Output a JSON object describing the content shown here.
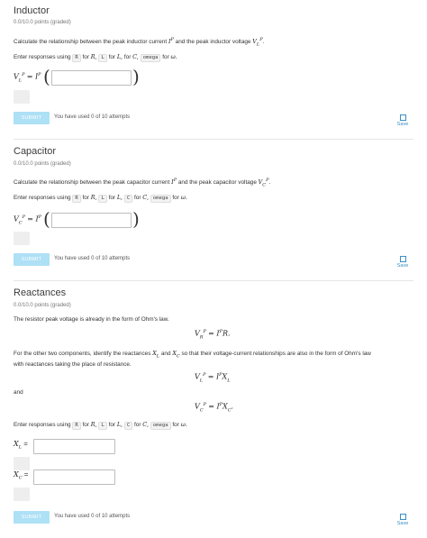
{
  "sections": [
    {
      "title": "Inductor",
      "points": "0.0/10.0 points (graded)",
      "prompt": "Calculate the relationship between the peak inductor current",
      "prompt_sym1": "I",
      "prompt_sym1_sup": "P",
      "prompt_mid": "and the peak inductor voltage",
      "prompt_sym2": "V",
      "prompt_sym2_sup": "P",
      "prompt_sym2_sub": "L",
      "prompt_end": ".",
      "enter_prefix": "Enter responses using",
      "codes": [
        "R",
        "L",
        "omega"
      ],
      "for_R": "for",
      "R": "R,",
      "for_L": "for",
      "L": "L,",
      "for_C": "for",
      "C": "C,",
      "for_w": "for",
      "w": "ω.",
      "eq_lhs": "V",
      "eq_lhs_sup": "P",
      "eq_lhs_sub": "L",
      "eq_mid": "= I",
      "eq_mid_sup": "P",
      "submit": "SUBMIT",
      "attempts": "You have used 0 of 10 attempts",
      "save": "Save"
    },
    {
      "title": "Capacitor",
      "points": "0.0/10.0 points (graded)",
      "prompt": "Calculate the relationship between the peak capacitor current",
      "prompt_sym1": "I",
      "prompt_sym1_sup": "P",
      "prompt_mid": "and the peak capacitor voltage",
      "prompt_sym2": "V",
      "prompt_sym2_sup": "P",
      "prompt_sym2_sub": "C",
      "prompt_end": ".",
      "enter_prefix": "Enter responses using",
      "codes": [
        "R",
        "L",
        "C",
        "omega"
      ],
      "for_R": "for",
      "R": "R,",
      "for_L": "for",
      "L": "L,",
      "for_C": "for",
      "C": "C,",
      "for_w": "for",
      "w": "ω.",
      "eq_lhs": "V",
      "eq_lhs_sup": "P",
      "eq_lhs_sub": "C",
      "eq_mid": "= I",
      "eq_mid_sup": "P",
      "submit": "SUBMIT",
      "attempts": "You have used 0 of 10 attempts",
      "save": "Save"
    },
    {
      "title": "Reactances",
      "points": "0.0/10.0 points (graded)",
      "p1": "The resistor peak voltage is already in the form of Ohm's law.",
      "eq1_lhs": "V",
      "eq1_lhs_sup": "P",
      "eq1_lhs_sub": "R",
      "eq1_rhs": "= I",
      "eq1_rhs_sup": "P",
      "eq1_rhs_end": "R.",
      "p2a": "For the other two components, identify the reactances",
      "p2_XL": "X",
      "p2_XL_sub": "L",
      "p2_and": "and",
      "p2_XC": "X",
      "p2_XC_sub": "C",
      "p2b": "so that their voltage-current relationships are also in the form of Ohm's law",
      "p2c": "with reactances taking the place of resistance.",
      "eq2_lhs": "V",
      "eq2_lhs_sup": "P",
      "eq2_lhs_sub": "L",
      "eq2_rhs": "= I",
      "eq2_rhs_sup": "P",
      "eq2_rhs_end": "X",
      "eq2_rhs_end_sub": "L",
      "and": "and",
      "eq3_lhs": "V",
      "eq3_lhs_sup": "P",
      "eq3_lhs_sub": "C",
      "eq3_rhs": "= I",
      "eq3_rhs_sup": "P",
      "eq3_rhs_end": "X",
      "eq3_rhs_end_sub": "C",
      "eq3_dot": ".",
      "enter_prefix": "Enter responses using",
      "codes": [
        "R",
        "L",
        "C",
        "omega"
      ],
      "for_R": "for",
      "R": "R,",
      "for_L": "for",
      "L": "L,",
      "for_C": "for",
      "C": "C,",
      "for_w": "for",
      "w": "ω.",
      "xl_label": "X",
      "xl_label_sub": "L",
      "xl_eq": "=",
      "xc_label": "X",
      "xc_label_sub": "C",
      "xc_eq": "=",
      "submit": "SUBMIT",
      "attempts": "You have used 0 of 10 attempts",
      "save": "Save"
    }
  ]
}
